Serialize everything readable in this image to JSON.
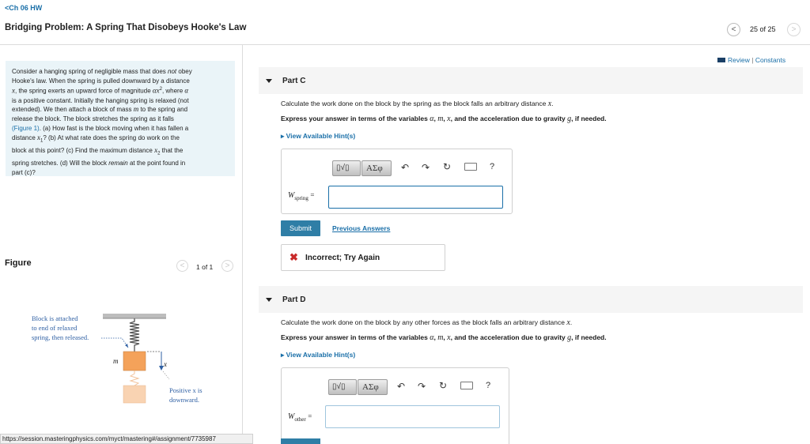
{
  "header": {
    "back_label": "Ch 06 HW",
    "title": "Bridging Problem: A Spring That Disobeys Hooke's Law",
    "counter": "25 of 25"
  },
  "toplinks": {
    "review": "Review",
    "sep": "|",
    "constants": "Constants"
  },
  "problem": {
    "lines": [
      [
        "Consider a hanging spring of negligible mass that does ",
        {
          "em": "not"
        },
        " obey"
      ],
      [
        "Hooke's law. When the spring is pulled downward by a distance"
      ],
      [
        {
          "m": "x"
        },
        ", the spring exerts an upward force of magnitude ",
        {
          "m": "αx"
        },
        {
          "sup": "2"
        },
        ", where ",
        {
          "m": "α"
        }
      ],
      [
        "is a positive constant. Initially the hanging spring is relaxed (not"
      ],
      [
        "extended). We then attach a block of mass ",
        {
          "m": "m"
        },
        " to the spring and"
      ],
      [
        "release the block. The block stretches the spring as it falls"
      ],
      [
        {
          "link": "(Figure 1)"
        },
        ". (a) How fast is the block moving when it has fallen a"
      ],
      [
        "distance ",
        {
          "m": "x"
        },
        {
          "sub": "1"
        },
        "? (b) At what rate does the spring do work on the"
      ],
      [
        "block at this point? (c) Find the maximum distance ",
        {
          "m": "x"
        },
        {
          "sub": "2"
        },
        " that the"
      ],
      [
        "spring stretches. (d) Will the block ",
        {
          "em": "remain"
        },
        " at the point found in"
      ],
      [
        "part (c)?"
      ]
    ]
  },
  "figure": {
    "label": "Figure",
    "pager": "1 of 1",
    "annotation_lines": [
      "Block is attached",
      "to end of relaxed",
      "spring, then released."
    ],
    "mass_label": "m",
    "x_label": "x",
    "positive_lines": [
      "Positive x is",
      "downward."
    ]
  },
  "status_url": "https://session.masteringphysics.com/myct/mastering#/assignment/7735987",
  "partC": {
    "title": "Part C",
    "prompt": "Calculate the work done on the block by the spring as the block falls an arbitrary distance x.",
    "express": "Express your answer in terms of the variables α, m, x, and the acceleration due to gravity g, if needed.",
    "hints": "View Available Hint(s)",
    "var_main": "W",
    "var_sub": "spring",
    "equals": "=",
    "input_value": "",
    "submit": "Submit",
    "previous": "Previous Answers",
    "feedback": "Incorrect; Try Again"
  },
  "partD": {
    "title": "Part D",
    "prompt": "Calculate the work done on the block by any other forces as the block falls an arbitrary distance x.",
    "express": "Express your answer in terms of the variables α, m, x, and the acceleration due to gravity g, if needed.",
    "hints": "View Available Hint(s)",
    "var_main": "W",
    "var_sub": "other",
    "equals": "=",
    "input_value": ""
  },
  "toolbar": {
    "templates_glyph": "▯√▯",
    "symbols_glyph": "ΑΣφ",
    "help_glyph": "?"
  },
  "colors": {
    "accent": "#1a6fa8",
    "submit": "#2f7ea6",
    "error": "#c92a2a",
    "problem_bg": "#eaf4f8"
  }
}
